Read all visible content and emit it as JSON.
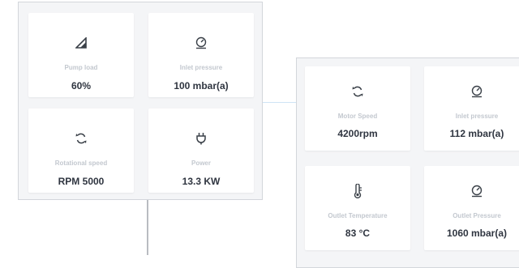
{
  "left_panel": {
    "cards": [
      {
        "icon": "signal-ramp-icon",
        "label": "Pump load",
        "value": "60%"
      },
      {
        "icon": "pressure-gauge-icon",
        "label": "Inlet pressure",
        "value": "100 mbar(a)"
      },
      {
        "icon": "rotation-icon",
        "label": "Rotational speed",
        "value": "RPM 5000"
      },
      {
        "icon": "plug-icon",
        "label": "Power",
        "value": "13.3 KW"
      }
    ]
  },
  "right_panel": {
    "cards": [
      {
        "icon": "rotation-icon",
        "label": "Motor Speed",
        "value": "4200rpm"
      },
      {
        "icon": "pressure-gauge-icon",
        "label": "Inlet pressure",
        "value": "112 mbar(a)"
      },
      {
        "icon": "thermometer-icon",
        "label": "Outlet Temperature",
        "value": "83 °C"
      },
      {
        "icon": "pressure-gauge-icon",
        "label": "Outlet Pressure",
        "value": "1060 mbar(a)"
      }
    ]
  },
  "colors": {
    "panel_bg": "#f4f5f7",
    "card_bg": "#ffffff",
    "label": "#c3c8cf",
    "value": "#2f3540",
    "icon": "#3a4048",
    "connector_h": "#cfe4f5",
    "connector_v": "#b9bcc1"
  }
}
